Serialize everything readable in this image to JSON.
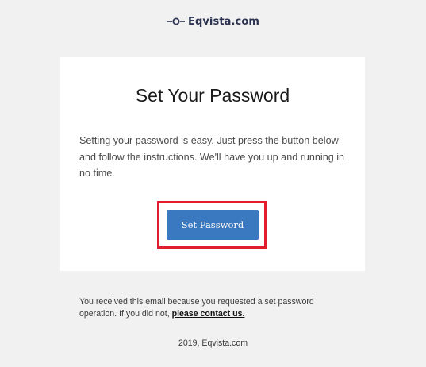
{
  "brand": {
    "name": "Eqvista.com",
    "icon": "eqvista-logo-icon",
    "color": "#2c3350"
  },
  "card": {
    "title": "Set Your Password",
    "body": "Setting your password is easy. Just press the button below and follow the instructions. We'll have you up and running in no time.",
    "button_label": "Set Password",
    "button_color": "#3a78bf",
    "highlight_color": "#e01e2d"
  },
  "footer": {
    "note_prefix": "You received this email because you requested a set password operation. If you did not, ",
    "contact_link": "please contact us.",
    "copyright": "2019, Eqvista.com"
  }
}
